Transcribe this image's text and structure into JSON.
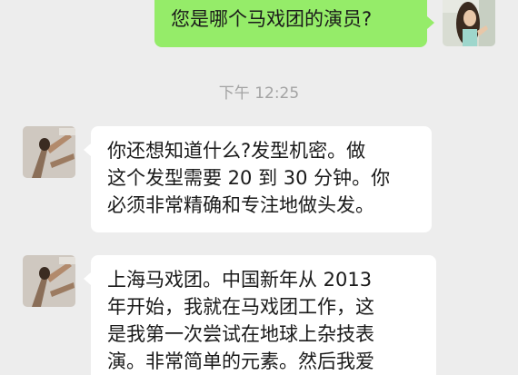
{
  "chat": {
    "messages": [
      {
        "direction": "out",
        "text": "您是哪个马戏团的演员?"
      },
      {
        "direction": "in",
        "lines": [
          "你还想知道什么?发型机密。做",
          "这个发型需要 20 到 30 分钟。你",
          "必须非常精确和专注地做头发。"
        ]
      },
      {
        "direction": "in",
        "lines": [
          "上海马戏团。中国新年从 2013",
          "年开始，我就在马戏团工作，这",
          "是我第一次尝试在地球上杂技表",
          "演。非常简单的元素。然后我爱"
        ]
      }
    ],
    "timestamp": "下午 12:25"
  },
  "colors": {
    "background": "#ededed",
    "outgoing_bubble": "#95ec69",
    "incoming_bubble": "#ffffff",
    "timestamp_text": "#a3a3a3"
  }
}
